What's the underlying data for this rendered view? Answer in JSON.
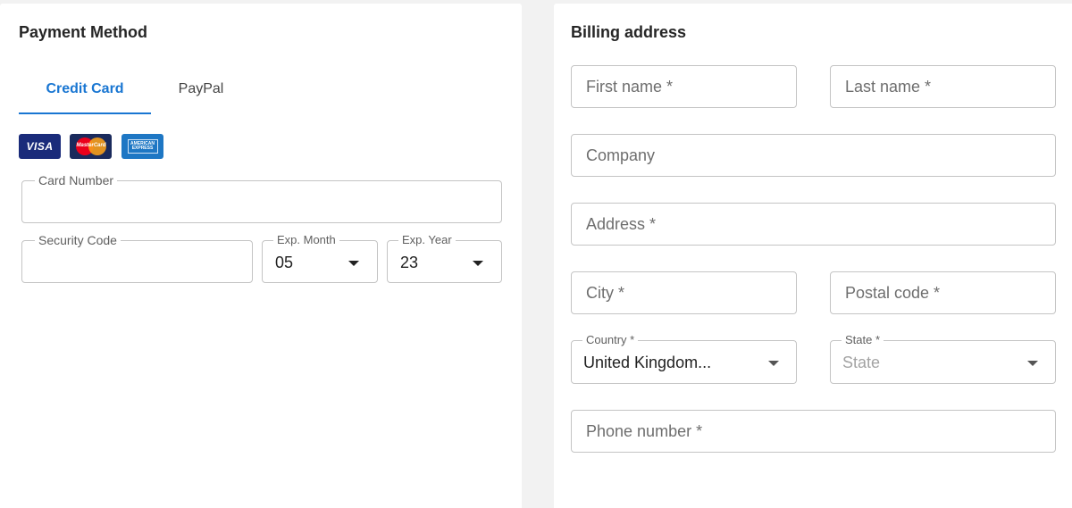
{
  "payment": {
    "title": "Payment Method",
    "tabs": [
      {
        "label": "Credit Card",
        "active": true
      },
      {
        "label": "PayPal",
        "active": false
      }
    ],
    "card_logos": {
      "visa": "VISA",
      "mastercard": "MasterCard",
      "amex": "AMERICAN EXPRESS"
    },
    "card_number_label": "Card Number",
    "card_number_value": "",
    "security_code_label": "Security Code",
    "security_code_value": "",
    "exp_month_label": "Exp. Month",
    "exp_month_value": "05",
    "exp_year_label": "Exp. Year",
    "exp_year_value": "23"
  },
  "billing": {
    "title": "Billing address",
    "first_name_placeholder": "First name *",
    "last_name_placeholder": "Last name *",
    "company_placeholder": "Company",
    "address_placeholder": "Address *",
    "city_placeholder": "City *",
    "postal_code_placeholder": "Postal code *",
    "country_label": "Country *",
    "country_value": "United Kingdom...",
    "state_label": "State *",
    "state_value": "State",
    "phone_placeholder": "Phone number *"
  },
  "colors": {
    "accent": "#1976d2",
    "background": "#f2f2f2",
    "border": "#c4c4c4"
  }
}
